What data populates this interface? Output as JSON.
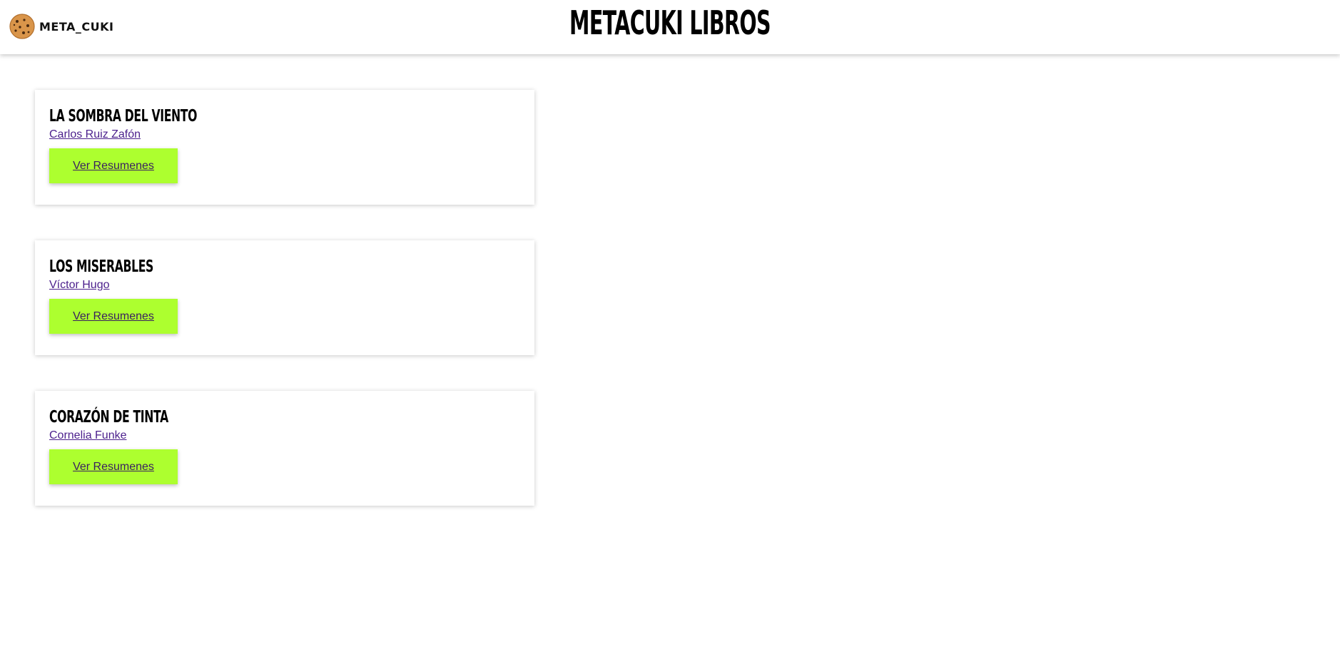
{
  "header": {
    "brand_name": "META_CUKI",
    "site_title": "METACUKI LIBROS"
  },
  "books": [
    {
      "title": "LA SOMBRA DEL VIENTO",
      "author": "Carlos Ruiz Zafón",
      "button_label": "Ver Resumenes"
    },
    {
      "title": "LOS MISERABLES",
      "author": "Víctor Hugo",
      "button_label": "Ver Resumenes"
    },
    {
      "title": "CORAZÓN DE TINTA",
      "author": "Cornelia Funke",
      "button_label": "Ver Resumenes"
    }
  ],
  "colors": {
    "button_bg": "#adff2f",
    "link": "#4b1f8c",
    "card_bg": "#ffffff"
  },
  "icons": {
    "brand_logo": "cookie-icon"
  }
}
